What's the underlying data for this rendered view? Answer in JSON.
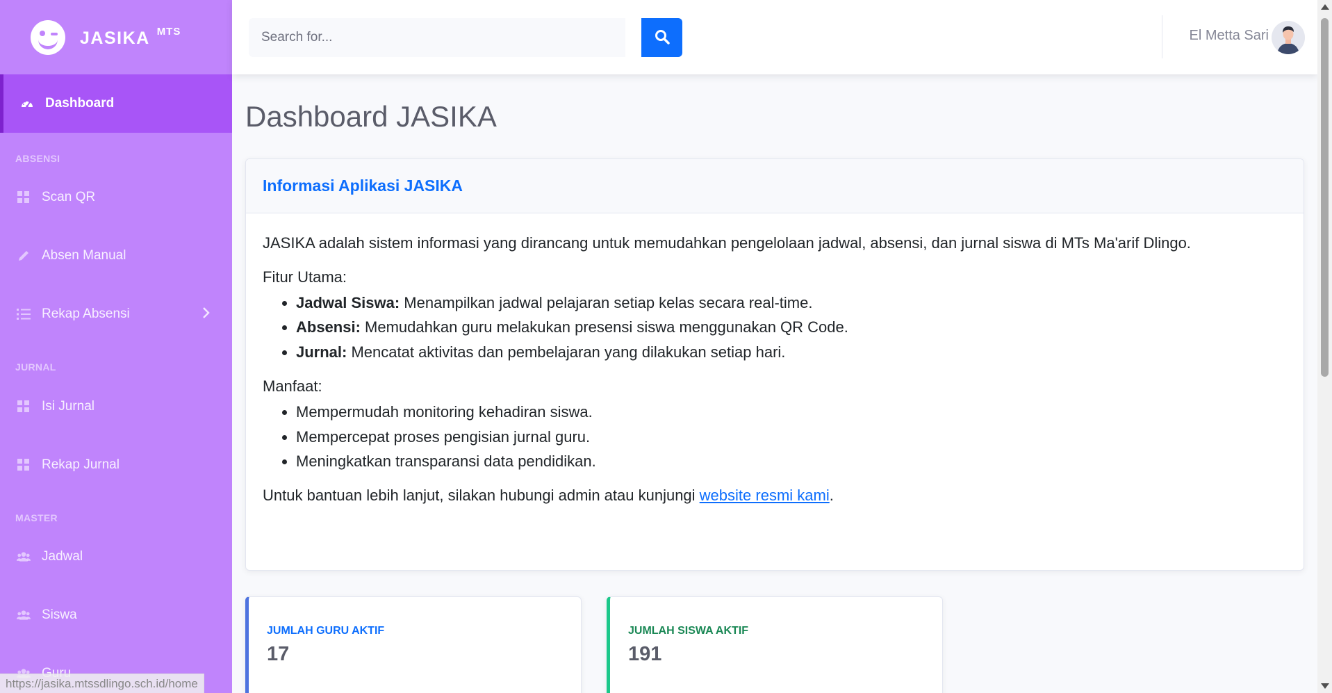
{
  "brand": {
    "name": "JASIKA",
    "suffix": "MTS"
  },
  "sidebar": {
    "active": {
      "label": "Dashboard"
    },
    "headings": {
      "absensi": "ABSENSI",
      "jurnal": "JURNAL",
      "master": "MASTER"
    },
    "items": [
      {
        "label": "Scan QR",
        "icon": "grid-icon"
      },
      {
        "label": "Absen Manual",
        "icon": "pencil-icon"
      },
      {
        "label": "Rekap Absensi",
        "icon": "list-icon",
        "chevron": true
      },
      {
        "label": "Isi Jurnal",
        "icon": "grid-icon"
      },
      {
        "label": "Rekap Jurnal",
        "icon": "grid-icon"
      },
      {
        "label": "Jadwal",
        "icon": "users-icon"
      },
      {
        "label": "Siswa",
        "icon": "users-icon"
      },
      {
        "label": "Guru",
        "icon": "users-icon"
      }
    ]
  },
  "topbar": {
    "search_placeholder": "Search for...",
    "user_name": "El Metta Sari"
  },
  "main": {
    "page_title": "Dashboard JASIKA",
    "info": {
      "title": "Informasi Aplikasi JASIKA",
      "intro": "JASIKA adalah sistem informasi yang dirancang untuk memudahkan pengelolaan jadwal, absensi, dan jurnal siswa di MTs Ma'arif Dlingo.",
      "features_label": "Fitur Utama:",
      "features": [
        {
          "title": "Jadwal Siswa:",
          "text": " Menampilkan jadwal pelajaran setiap kelas secara real-time."
        },
        {
          "title": "Absensi:",
          "text": " Memudahkan guru melakukan presensi siswa menggunakan QR Code."
        },
        {
          "title": "Jurnal:",
          "text": " Mencatat aktivitas dan pembelajaran yang dilakukan setiap hari."
        }
      ],
      "benefits_label": "Manfaat:",
      "benefits": [
        "Mempermudah monitoring kehadiran siswa.",
        "Mempercepat proses pengisian jurnal guru.",
        "Meningkatkan transparansi data pendidikan."
      ],
      "help_text": "Untuk bantuan lebih lanjut, silakan hubungi admin atau kunjungi ",
      "help_link": "website resmi kami",
      "help_end": "."
    },
    "stats": [
      {
        "label": "JUMLAH GURU AKTIF",
        "value": "17"
      },
      {
        "label": "JUMLAH SISWA AKTIF",
        "value": "191"
      }
    ]
  },
  "status_bar": {
    "url": "https://jasika.mtssdlingo.sch.id/home"
  },
  "colors": {
    "sidebar": "#c084fc",
    "sidebar_active": "#a855f7",
    "primary": "#0d6efd",
    "success": "#198754"
  }
}
